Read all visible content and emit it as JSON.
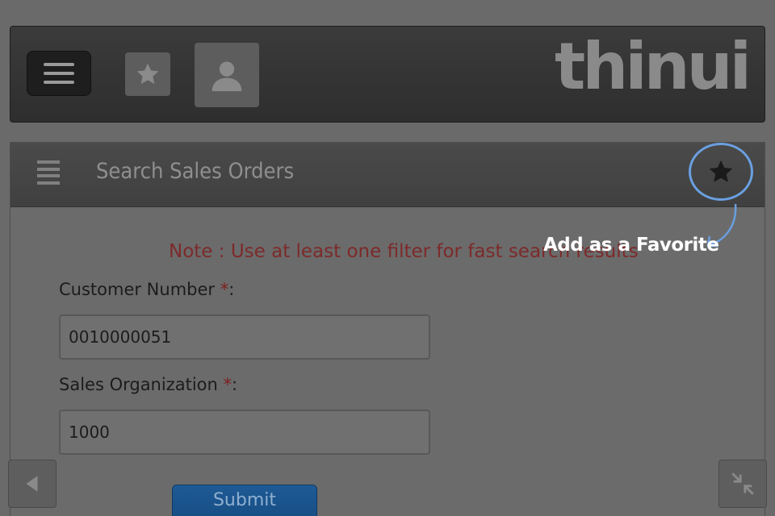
{
  "header": {
    "logo_text": "thinui",
    "menu_icon": "hamburger-icon",
    "favorites_icon": "star-icon",
    "user_icon": "user-icon"
  },
  "page": {
    "title": "Search Sales Orders",
    "menu_icon": "list-icon",
    "favorite_icon": "star-icon",
    "favorite_callout": "Add as a Favorite"
  },
  "form": {
    "note": "Note : Use at least one filter for fast search results",
    "fields": [
      {
        "label": "Customer Number ",
        "required_mark": "*",
        "suffix": ":",
        "value": "0010000051"
      },
      {
        "label": "Sales Organization ",
        "required_mark": "*",
        "suffix": ":",
        "value": "1000"
      }
    ],
    "submit_label": "Submit"
  },
  "nav": {
    "back_icon": "back-arrow-icon",
    "shrink_icon": "collapse-icon"
  },
  "colors": {
    "accent": "#6a9fe0",
    "required": "#7d2020",
    "note": "#7d2a2a",
    "submit": "#1e5a96"
  }
}
